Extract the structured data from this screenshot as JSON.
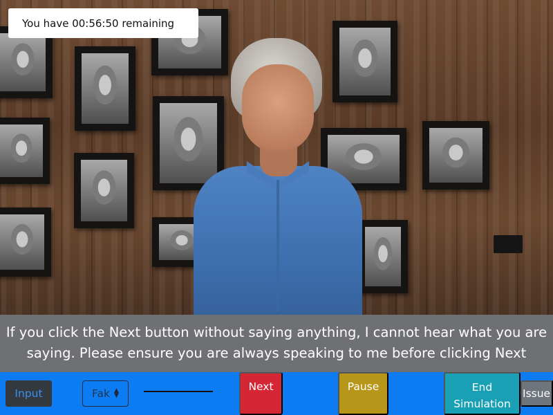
{
  "timer": {
    "text": "You have 00:56:50 remaining"
  },
  "caption": {
    "text": "If you click the Next button without saying anything, I cannot hear what you are saying. Please ensure you are always speaking to me before clicking Next"
  },
  "toolbar": {
    "input_label": "Input",
    "select_value": "Fak",
    "next_label": "Next",
    "pause_label": "Pause",
    "end_label_line1": "End",
    "end_label_line2": "Simulation",
    "issue_label": "Issue"
  },
  "colors": {
    "toolbar_bg": "#0d7cf2",
    "next_button": "#d52636",
    "pause_button": "#b7961a",
    "end_button": "#1aa0b5",
    "issue_button": "#6f757c",
    "caption_bg": "#6e7073"
  },
  "icons": {
    "select_arrows": "chevron-up-down-icon"
  }
}
